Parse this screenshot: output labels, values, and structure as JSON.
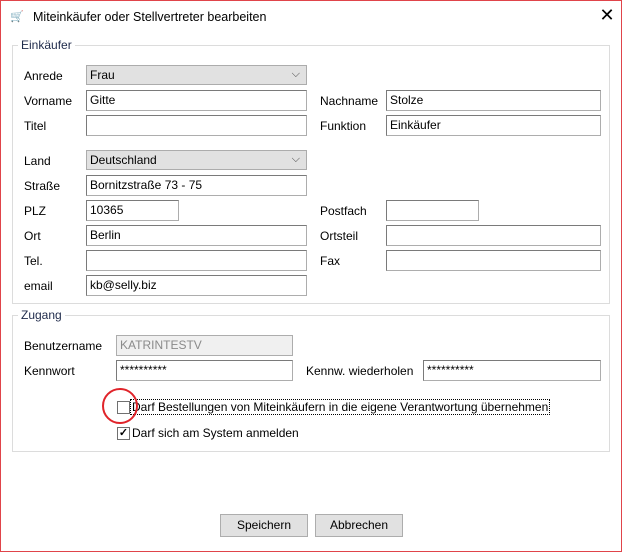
{
  "window": {
    "title": "Miteinkäufer oder Stellvertreter bearbeiten",
    "close": "✕",
    "app_icon": "cart-icon"
  },
  "einkaeufer": {
    "legend": "Einkäufer",
    "anrede": {
      "label": "Anrede",
      "value": "Frau"
    },
    "vorname": {
      "label": "Vorname",
      "value": "Gitte"
    },
    "nachname": {
      "label": "Nachname",
      "value": "Stolze"
    },
    "titel": {
      "label": "Titel",
      "value": ""
    },
    "funktion": {
      "label": "Funktion",
      "value": "Einkäufer"
    },
    "land": {
      "label": "Land",
      "value": "Deutschland"
    },
    "strasse": {
      "label": "Straße",
      "value": "Bornitzstraße 73 - 75"
    },
    "plz": {
      "label": "PLZ",
      "value": "10365"
    },
    "postfach": {
      "label": "Postfach",
      "value": ""
    },
    "ort": {
      "label": "Ort",
      "value": "Berlin"
    },
    "ortsteil": {
      "label": "Ortsteil",
      "value": ""
    },
    "tel": {
      "label": "Tel.",
      "value": ""
    },
    "fax": {
      "label": "Fax",
      "value": ""
    },
    "email": {
      "label": "email",
      "value": "kb@selly.biz"
    }
  },
  "zugang": {
    "legend": "Zugang",
    "benutzername": {
      "label": "Benutzername",
      "value": "KATRINTESTV"
    },
    "kennwort": {
      "label": "Kennwort",
      "value": "**********"
    },
    "kennwort2": {
      "label": "Kennw. wiederholen",
      "value": "**********"
    },
    "cb_bestellungen": {
      "label": "Darf Bestellungen von Miteinkäufern in die eigene Verantwortung übernehmen",
      "checked": false
    },
    "cb_anmelden": {
      "label": "Darf sich am System anmelden",
      "checked": true
    }
  },
  "buttons": {
    "save": "Speichern",
    "cancel": "Abbrechen"
  },
  "colors": {
    "highlight_circle": "#e0242a",
    "window_border": "#e0444a"
  }
}
